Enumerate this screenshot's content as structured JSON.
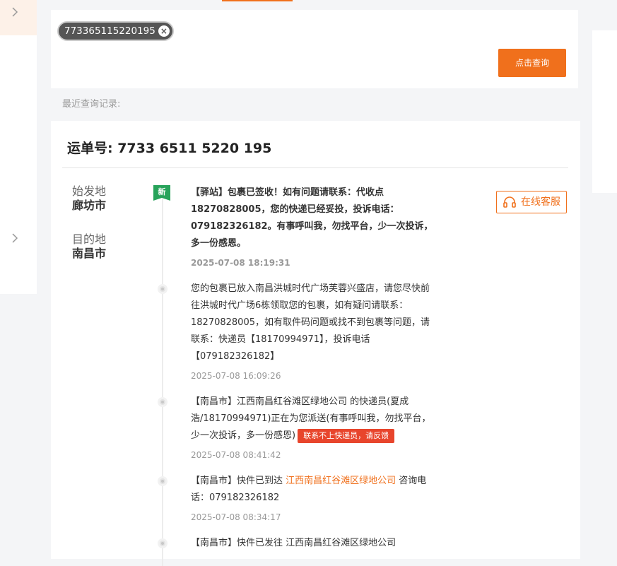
{
  "search": {
    "chip_value": "773365115220195",
    "query_button": "点击查询"
  },
  "recent": {
    "label": "最近查询记录:"
  },
  "result": {
    "waybill_title": "运单号: 7733 6511 5220 195",
    "origin_label": "始发地",
    "origin_city": "廊坊市",
    "dest_label": "目的地",
    "dest_city": "南昌市",
    "new_badge": "新",
    "service_button": "在线客服",
    "events": [
      {
        "text": "【驿站】包裹已签收！如有问题请联系：代收点18270828005，您的快递已经妥投，投诉电话：079182326182。有事呼叫我，勿找平台，少一次投诉，多一份感恩。",
        "time": "2025-07-08 18:19:31"
      },
      {
        "text": "您的包裹已放入南昌洪城时代广场芙蓉兴盛店，请您尽快前往洪城时代广场6栋领取您的包裹，如有疑问请联系：18270828005，如有取件码问题或找不到包裹等问题，请联系：快递员【18170994971】，投诉电话【079182326182】",
        "time": "2025-07-08 16:09:26"
      },
      {
        "text": "【南昌市】江西南昌红谷滩区绿地公司 的快递员(夏成浩/18170994971)正在为您派送(有事呼叫我，勿找平台，少一次投诉，多一份感恩)",
        "tag": "联系不上快递员，请反馈",
        "time": "2025-07-08 08:41:42"
      },
      {
        "prefix": "【南昌市】快件已到达 ",
        "link": "江西南昌红谷滩区绿地公司",
        "suffix": " 咨询电话：079182326182",
        "time": "2025-07-08 08:34:17"
      },
      {
        "text": "【南昌市】快件已发往 江西南昌红谷滩区绿地公司"
      }
    ]
  },
  "colors": {
    "accent": "#f0701c",
    "new_badge": "#27a35a",
    "warn_tag": "#e8452c"
  },
  "icons": {
    "chevron": "chevron-right-icon",
    "close": "close-icon",
    "headset": "headset-icon"
  }
}
